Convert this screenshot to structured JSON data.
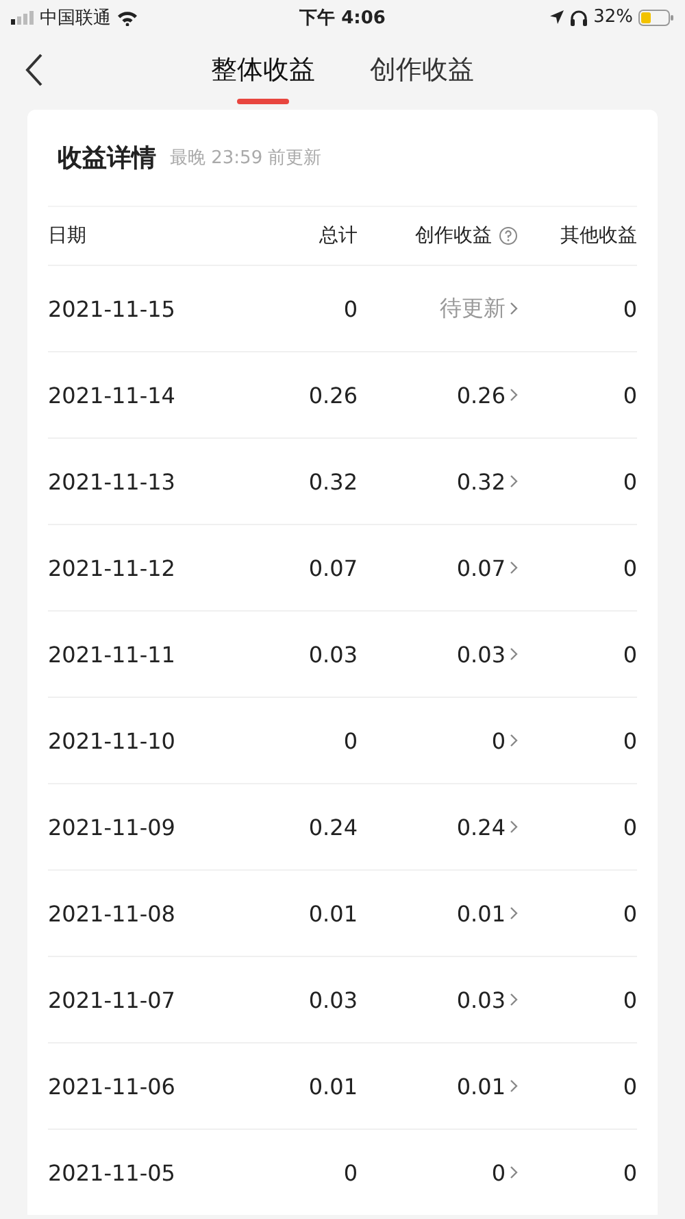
{
  "status_bar": {
    "carrier": "中国联通",
    "time": "下午 4:06",
    "battery": "32%"
  },
  "tabs": [
    {
      "label": "整体收益",
      "selected": true
    },
    {
      "label": "创作收益",
      "selected": false
    }
  ],
  "card": {
    "title": "收益详情",
    "subtitle": "最晚 23:59 前更新",
    "columns": [
      "日期",
      "总计",
      "创作收益",
      "其他收益"
    ],
    "rows": [
      {
        "date": "2021-11-15",
        "total": "0",
        "creation": "待更新",
        "pending": true,
        "other": "0"
      },
      {
        "date": "2021-11-14",
        "total": "0.26",
        "creation": "0.26",
        "pending": false,
        "other": "0"
      },
      {
        "date": "2021-11-13",
        "total": "0.32",
        "creation": "0.32",
        "pending": false,
        "other": "0"
      },
      {
        "date": "2021-11-12",
        "total": "0.07",
        "creation": "0.07",
        "pending": false,
        "other": "0"
      },
      {
        "date": "2021-11-11",
        "total": "0.03",
        "creation": "0.03",
        "pending": false,
        "other": "0"
      },
      {
        "date": "2021-11-10",
        "total": "0",
        "creation": "0",
        "pending": false,
        "other": "0"
      },
      {
        "date": "2021-11-09",
        "total": "0.24",
        "creation": "0.24",
        "pending": false,
        "other": "0"
      },
      {
        "date": "2021-11-08",
        "total": "0.01",
        "creation": "0.01",
        "pending": false,
        "other": "0"
      },
      {
        "date": "2021-11-07",
        "total": "0.03",
        "creation": "0.03",
        "pending": false,
        "other": "0"
      },
      {
        "date": "2021-11-06",
        "total": "0.01",
        "creation": "0.01",
        "pending": false,
        "other": "0"
      },
      {
        "date": "2021-11-05",
        "total": "0",
        "creation": "0",
        "pending": false,
        "other": "0"
      }
    ]
  }
}
